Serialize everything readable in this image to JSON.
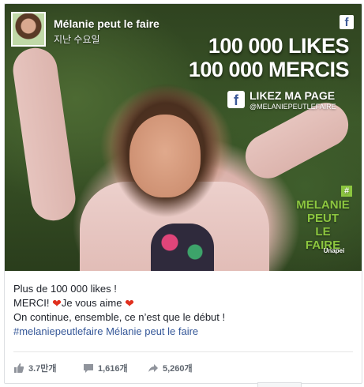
{
  "page": {
    "name": "Mélanie peut le faire",
    "post_time": "지난 수요일",
    "fb_icon": "facebook-icon"
  },
  "image_overlay": {
    "headline_1": "100 000 LIKES",
    "headline_2": "100 000 MERCIS",
    "like_page": "LIKEZ MA PAGE",
    "handle": "@MELANIEPEUTLEFAIRE",
    "logo_lines": [
      "MELANIE",
      "PEUT",
      "LE",
      "FAIRE"
    ],
    "logo_hash": "#",
    "partner": "Unapei",
    "brand_colors": {
      "logo_green": "#8cc63f",
      "facebook_blue": "#3b5998"
    }
  },
  "message": {
    "line1": "Plus de 100 000 likes !",
    "line2_a": "MERCI!",
    "line2_b": "Je vous aime",
    "line3": "On continue, ensemble, ce n’est que le début !",
    "hashtag": "#melaniepeutlefaire",
    "page_mention": "Mélanie peut le faire",
    "heart_icon": "heart-icon"
  },
  "stats": {
    "likes": "3.7만개",
    "comments": "1,616개",
    "shares": "5,260개"
  }
}
